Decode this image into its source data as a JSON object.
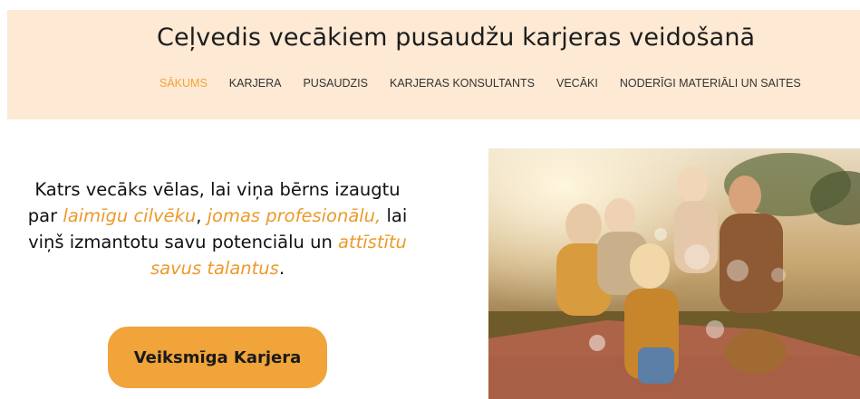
{
  "header": {
    "title": "Ceļvedis vecākiem pusaudžu karjeras veidošanā",
    "nav": [
      {
        "label": "SĀKUMS",
        "active": true
      },
      {
        "label": "KARJERA",
        "active": false
      },
      {
        "label": "PUSAUDZIS",
        "active": false
      },
      {
        "label": "KARJERAS KONSULTANTS",
        "active": false
      },
      {
        "label": "VECĀKI",
        "active": false
      },
      {
        "label": "NODERĪGI MATERIĀLI UN SAITES",
        "active": false
      }
    ]
  },
  "hero": {
    "t1": "Katrs vecāks vēlas, lai viņa bērns izaugtu par ",
    "hl1": "laimīgu cilvēku",
    "t2": ",  ",
    "hl2": "jomas profesionālu,",
    "t3": " lai viņš izmantotu savu potenciālu un ",
    "hl3": "attīstītu savus talantus",
    "t4": ".",
    "cta_label": "Veiksmīga Karjera"
  },
  "photo": {
    "description_icon": "family-picnic-photo"
  },
  "colors": {
    "header_bg": "#fde9d4",
    "accent": "#f0a43a",
    "highlight_text": "#ec9a2c"
  }
}
